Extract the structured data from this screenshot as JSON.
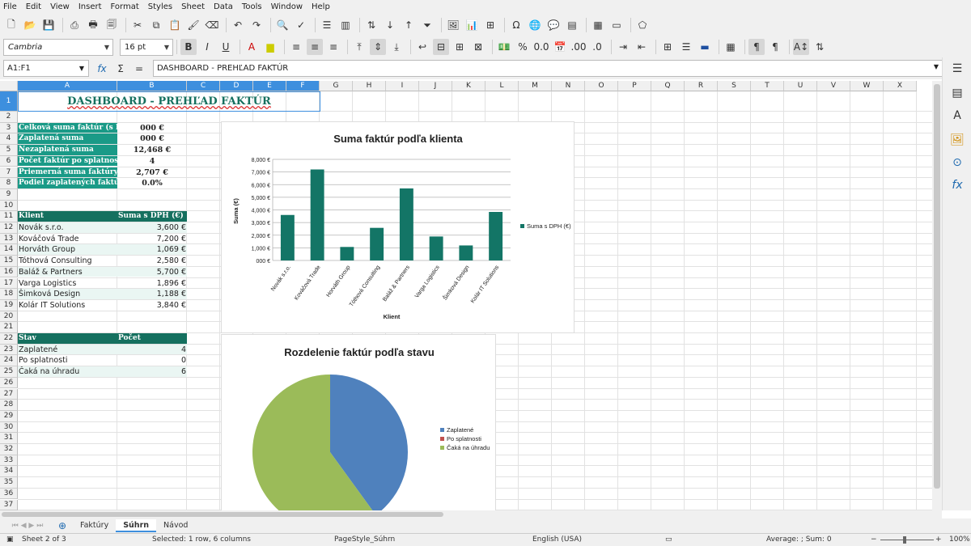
{
  "menu": [
    "File",
    "Edit",
    "View",
    "Insert",
    "Format",
    "Styles",
    "Sheet",
    "Data",
    "Tools",
    "Window",
    "Help"
  ],
  "toolbar": {
    "font_name": "Cambria",
    "font_size": "16 pt"
  },
  "formula": {
    "cell_ref": "A1:F1",
    "content": "DASHBOARD - PREHĽAD FAKTÚR"
  },
  "columns": [
    "A",
    "B",
    "C",
    "D",
    "E",
    "F",
    "G",
    "H",
    "I",
    "J",
    "K",
    "L",
    "M",
    "N",
    "O",
    "P",
    "Q",
    "R",
    "S",
    "T",
    "U",
    "V",
    "W",
    "X"
  ],
  "rows": [
    "1",
    "2",
    "3",
    "4",
    "5",
    "6",
    "7",
    "8",
    "9",
    "10",
    "11",
    "12",
    "13",
    "14",
    "15",
    "16",
    "17",
    "18",
    "19",
    "20",
    "21",
    "22",
    "23",
    "24",
    "25",
    "26",
    "27",
    "28",
    "29",
    "30",
    "31",
    "32",
    "33",
    "34",
    "35",
    "36",
    "37"
  ],
  "title": "DASHBOARD - PREHĽAD FAKTÚR",
  "summary": [
    {
      "label": "Celková suma faktúr (s DPH)",
      "value": "000 €"
    },
    {
      "label": "Zaplatená suma",
      "value": "000 €"
    },
    {
      "label": "Nezaplatená suma",
      "value": "12,468 €"
    },
    {
      "label": "Počet faktúr po splatnosti",
      "value": "4"
    },
    {
      "label": "Priemerná suma faktúry",
      "value": "2,707 €"
    },
    {
      "label": "Podiel zaplatených faktúr",
      "value": "0.0%"
    }
  ],
  "clients_header": {
    "col1": "Klient",
    "col2": "Suma s DPH (€)"
  },
  "clients": [
    {
      "name": "Novák s.r.o.",
      "amount": "3,600 €"
    },
    {
      "name": "Kováčová Trade",
      "amount": "7,200 €"
    },
    {
      "name": "Horváth Group",
      "amount": "1,069 €"
    },
    {
      "name": "Tóthová Consulting",
      "amount": "2,580 €"
    },
    {
      "name": "Baláž & Partners",
      "amount": "5,700 €"
    },
    {
      "name": "Varga Logistics",
      "amount": "1,896 €"
    },
    {
      "name": "Šimková Design",
      "amount": "1,188 €"
    },
    {
      "name": "Kolár IT Solutions",
      "amount": "3,840 €"
    }
  ],
  "status_header": {
    "col1": "Stav",
    "col2": "Počet"
  },
  "status_rows": [
    {
      "name": "Zaplatené",
      "count": "4"
    },
    {
      "name": "Po splatnosti",
      "count": "0"
    },
    {
      "name": "Čaká na úhradu",
      "count": "6"
    }
  ],
  "colors": {
    "accent": "#1a9a87",
    "dark_teal": "#15705f",
    "bar": "#137566",
    "pie_blue": "#4f81bd",
    "pie_red": "#c0504d",
    "pie_green": "#9bbb59",
    "selection": "#3d8fde"
  },
  "chart_data": [
    {
      "type": "bar",
      "title": "Suma faktúr podľa klienta",
      "xlabel": "Klient",
      "ylabel": "Suma (€)",
      "categories": [
        "Novák s.r.o.",
        "Kováčová Trade",
        "Horváth Group",
        "Tóthová Consulting",
        "Baláž & Partners",
        "Varga Logistics",
        "Šimková Design",
        "Kolár IT Solutions"
      ],
      "series": [
        {
          "name": "Suma s DPH (€)",
          "values": [
            3600,
            7200,
            1069,
            2580,
            5700,
            1896,
            1188,
            3840
          ]
        }
      ],
      "ylim": [
        0,
        8000
      ],
      "yticks": [
        "000 €",
        "1,000 €",
        "2,000 €",
        "3,000 €",
        "4,000 €",
        "5,000 €",
        "6,000 €",
        "7,000 €",
        "8,000 €"
      ],
      "legend": "right",
      "grid": true
    },
    {
      "type": "pie",
      "title": "Rozdelenie faktúr podľa stavu",
      "categories": [
        "Zaplatené",
        "Po splatnosti",
        "Čaká na úhradu"
      ],
      "values": [
        4,
        0,
        6
      ],
      "legend": "right"
    }
  ],
  "sheet_tabs": [
    "Faktúry",
    "Súhrn",
    "Návod"
  ],
  "statusbar": {
    "sheet": "Sheet 2 of 3",
    "selected": "Selected: 1 row, 6 columns",
    "pagestyle": "PageStyle_Súhrn",
    "lang": "English (USA)",
    "sum": "Average: ; Sum: 0",
    "zoom": "100%"
  }
}
